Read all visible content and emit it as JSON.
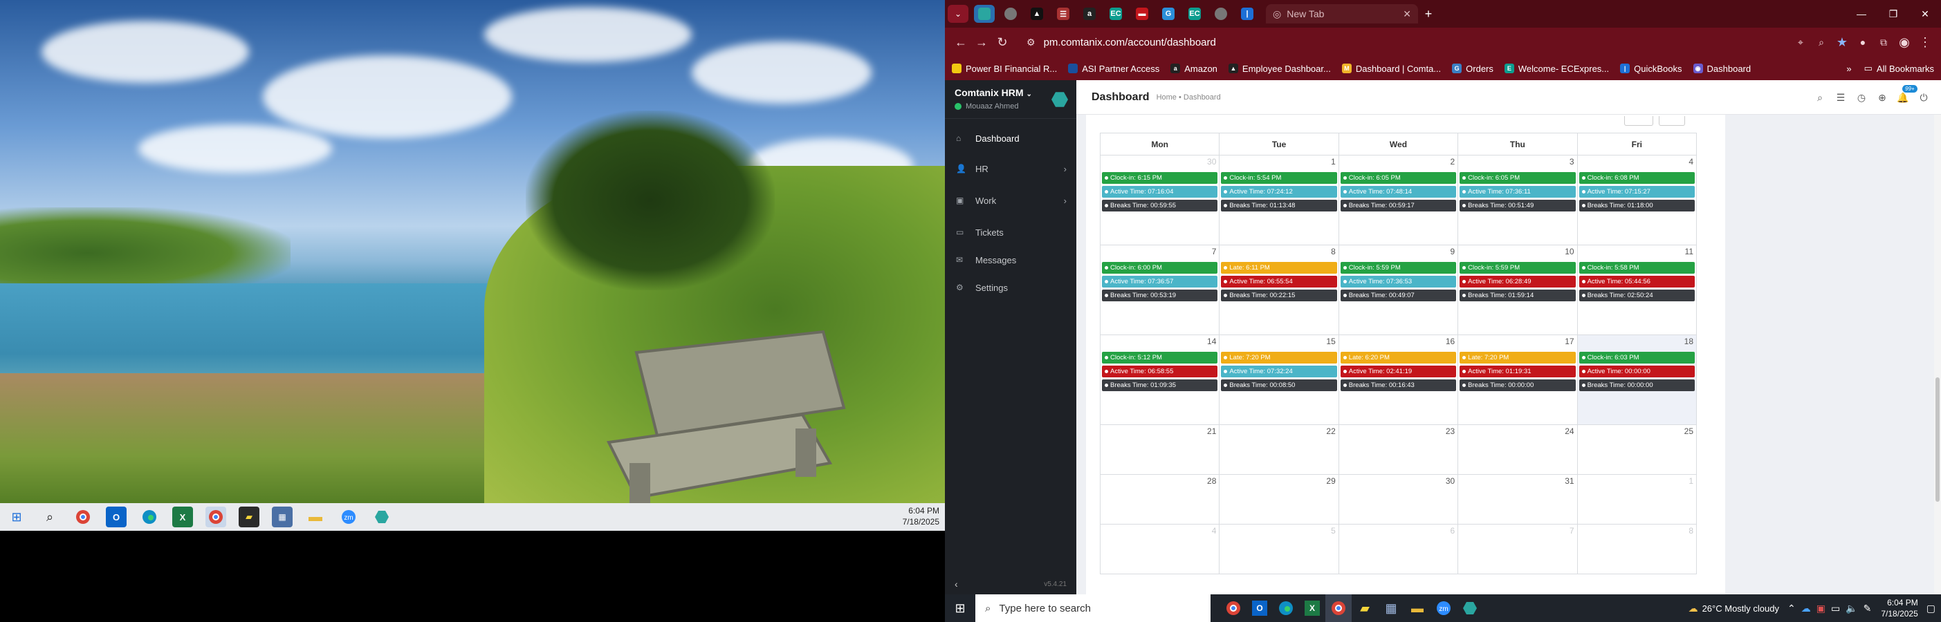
{
  "left_screen": {
    "taskbar": {
      "icons": [
        "windows-icon",
        "search-icon",
        "chrome-icon",
        "outlook-icon",
        "edge-icon",
        "excel-icon",
        "chrome-icon",
        "sticky-icon",
        "calculator-icon",
        "files-icon",
        "zoom-icon",
        "app-icon"
      ],
      "time": "6:04 PM",
      "date": "7/18/2025"
    }
  },
  "browser": {
    "tab_title": "New Tab",
    "url": "pm.comtanix.com/account/dashboard",
    "bookmarks": [
      {
        "label": "Power BI Financial R...",
        "color": "#f2c811"
      },
      {
        "label": "ASI Partner Access",
        "color": "#1a4f9c"
      },
      {
        "label": "Amazon",
        "color": "#222"
      },
      {
        "label": "Employee Dashboar...",
        "color": "#222"
      },
      {
        "label": "Dashboard | Comta...",
        "color": "#f0b429"
      },
      {
        "label": "Orders",
        "color": "#3b7fc4"
      },
      {
        "label": "Welcome- ECExpres...",
        "color": "#0d9d8f"
      },
      {
        "label": "QuickBooks",
        "color": "#1d6fd6"
      },
      {
        "label": "Dashboard",
        "color": "#6a5acd"
      }
    ],
    "all_bookmarks": "All Bookmarks"
  },
  "app": {
    "name": "Comtanix HRM",
    "user": "Mouaaz Ahmed",
    "nav": [
      {
        "label": "Dashboard",
        "icon": "home-icon"
      },
      {
        "label": "HR",
        "icon": "users-icon"
      },
      {
        "label": "Work",
        "icon": "briefcase-icon"
      },
      {
        "label": "Tickets",
        "icon": "ticket-icon"
      },
      {
        "label": "Messages",
        "icon": "message-icon"
      },
      {
        "label": "Settings",
        "icon": "gear-icon"
      }
    ],
    "version": "v5.4.21",
    "page_title": "Dashboard",
    "breadcrumb": "Home • Dashboard",
    "notification_count": "99+"
  },
  "calendar": {
    "days": [
      "Mon",
      "Tue",
      "Wed",
      "Thu",
      "Fri"
    ],
    "weeks": [
      [
        {
          "num": "30",
          "dim": true,
          "events": [
            {
              "t": "Clock-in: 6:15 PM",
              "c": "green"
            },
            {
              "t": "Active Time: 07:16:04",
              "c": "teal"
            },
            {
              "t": "Breaks Time: 00:59:55",
              "c": "dark"
            }
          ]
        },
        {
          "num": "1",
          "events": [
            {
              "t": "Clock-in: 5:54 PM",
              "c": "green"
            },
            {
              "t": "Active Time: 07:24:12",
              "c": "teal"
            },
            {
              "t": "Breaks Time: 01:13:48",
              "c": "dark"
            }
          ]
        },
        {
          "num": "2",
          "events": [
            {
              "t": "Clock-in: 6:05 PM",
              "c": "green"
            },
            {
              "t": "Active Time: 07:48:14",
              "c": "teal"
            },
            {
              "t": "Breaks Time: 00:59:17",
              "c": "dark"
            }
          ]
        },
        {
          "num": "3",
          "events": [
            {
              "t": "Clock-in: 6:05 PM",
              "c": "green"
            },
            {
              "t": "Active Time: 07:36:11",
              "c": "teal"
            },
            {
              "t": "Breaks Time: 00:51:49",
              "c": "dark"
            }
          ]
        },
        {
          "num": "4",
          "events": [
            {
              "t": "Clock-in: 6:08 PM",
              "c": "green"
            },
            {
              "t": "Active Time: 07:15:27",
              "c": "teal"
            },
            {
              "t": "Breaks Time: 01:18:00",
              "c": "dark"
            }
          ]
        }
      ],
      [
        {
          "num": "7",
          "events": [
            {
              "t": "Clock-in: 6:00 PM",
              "c": "green"
            },
            {
              "t": "Active Time: 07:36:57",
              "c": "teal"
            },
            {
              "t": "Breaks Time: 00:53:19",
              "c": "dark"
            }
          ]
        },
        {
          "num": "8",
          "events": [
            {
              "t": "Late: 6:11 PM",
              "c": "amber"
            },
            {
              "t": "Active Time: 06:55:54",
              "c": "red"
            },
            {
              "t": "Breaks Time: 00:22:15",
              "c": "dark"
            }
          ]
        },
        {
          "num": "9",
          "events": [
            {
              "t": "Clock-in: 5:59 PM",
              "c": "green"
            },
            {
              "t": "Active Time: 07:36:53",
              "c": "teal"
            },
            {
              "t": "Breaks Time: 00:49:07",
              "c": "dark"
            }
          ]
        },
        {
          "num": "10",
          "events": [
            {
              "t": "Clock-in: 5:59 PM",
              "c": "green"
            },
            {
              "t": "Active Time: 06:28:49",
              "c": "red"
            },
            {
              "t": "Breaks Time: 01:59:14",
              "c": "dark"
            }
          ]
        },
        {
          "num": "11",
          "events": [
            {
              "t": "Clock-in: 5:58 PM",
              "c": "green"
            },
            {
              "t": "Active Time: 05:44:56",
              "c": "red"
            },
            {
              "t": "Breaks Time: 02:50:24",
              "c": "dark"
            }
          ]
        }
      ],
      [
        {
          "num": "14",
          "events": [
            {
              "t": "Clock-in: 5:12 PM",
              "c": "green"
            },
            {
              "t": "Active Time: 06:58:55",
              "c": "red"
            },
            {
              "t": "Breaks Time: 01:09:35",
              "c": "dark"
            }
          ]
        },
        {
          "num": "15",
          "events": [
            {
              "t": "Late: 7:20 PM",
              "c": "amber"
            },
            {
              "t": "Active Time: 07:32:24",
              "c": "teal"
            },
            {
              "t": "Breaks Time: 00:08:50",
              "c": "dark"
            }
          ]
        },
        {
          "num": "16",
          "events": [
            {
              "t": "Late: 6:20 PM",
              "c": "amber"
            },
            {
              "t": "Active Time: 02:41:19",
              "c": "red"
            },
            {
              "t": "Breaks Time: 00:16:43",
              "c": "dark"
            }
          ]
        },
        {
          "num": "17",
          "events": [
            {
              "t": "Late: 7:20 PM",
              "c": "amber"
            },
            {
              "t": "Active Time: 01:19:31",
              "c": "red"
            },
            {
              "t": "Breaks Time: 00:00:00",
              "c": "dark"
            }
          ]
        },
        {
          "num": "18",
          "today": true,
          "events": [
            {
              "t": "Clock-in: 6:03 PM",
              "c": "green"
            },
            {
              "t": "Active Time: 00:00:00",
              "c": "red"
            },
            {
              "t": "Breaks Time: 00:00:00",
              "c": "dark"
            }
          ]
        }
      ],
      [
        {
          "num": "21",
          "events": []
        },
        {
          "num": "22",
          "events": []
        },
        {
          "num": "23",
          "events": []
        },
        {
          "num": "24",
          "events": []
        },
        {
          "num": "25",
          "events": []
        }
      ],
      [
        {
          "num": "28",
          "events": []
        },
        {
          "num": "29",
          "events": []
        },
        {
          "num": "30",
          "events": []
        },
        {
          "num": "31",
          "events": []
        },
        {
          "num": "1",
          "dim": true,
          "events": []
        }
      ],
      [
        {
          "num": "4",
          "dim": true,
          "events": []
        },
        {
          "num": "5",
          "dim": true,
          "events": []
        },
        {
          "num": "6",
          "dim": true,
          "events": []
        },
        {
          "num": "7",
          "dim": true,
          "events": []
        },
        {
          "num": "8",
          "dim": true,
          "events": []
        }
      ]
    ]
  },
  "right_taskbar": {
    "search_placeholder": "Type here to search",
    "weather": "26°C  Mostly cloudy",
    "time": "6:04 PM",
    "date": "7/18/2025"
  }
}
